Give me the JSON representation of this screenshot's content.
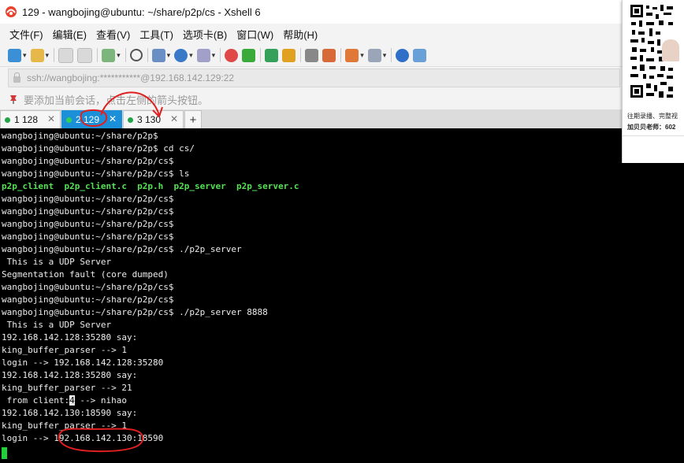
{
  "window": {
    "title": "129 - wangbojing@ubuntu: ~/share/p2p/cs - Xshell 6"
  },
  "menu": {
    "items": [
      {
        "label": "文件(F)"
      },
      {
        "label": "编辑(E)"
      },
      {
        "label": "查看(V)"
      },
      {
        "label": "工具(T)"
      },
      {
        "label": "选项卡(B)"
      },
      {
        "label": "窗口(W)"
      },
      {
        "label": "帮助(H)"
      }
    ]
  },
  "address": {
    "text": "ssh://wangbojing:***********@192.168.142.129:22"
  },
  "hint": {
    "text": "要添加当前会话，点击左侧的箭头按钮。"
  },
  "tabs": [
    {
      "label": "1 128",
      "active": false
    },
    {
      "label": "2 129",
      "active": true
    },
    {
      "label": "3 130",
      "active": false
    }
  ],
  "terminal": {
    "lines": [
      "wangbojing@ubuntu:~/share/p2p$",
      "wangbojing@ubuntu:~/share/p2p$ cd cs/",
      "wangbojing@ubuntu:~/share/p2p/cs$",
      "wangbojing@ubuntu:~/share/p2p/cs$ ls",
      "p2p_client  p2p_client.c  p2p.h  p2p_server  p2p_server.c",
      "wangbojing@ubuntu:~/share/p2p/cs$",
      "wangbojing@ubuntu:~/share/p2p/cs$",
      "wangbojing@ubuntu:~/share/p2p/cs$",
      "wangbojing@ubuntu:~/share/p2p/cs$",
      "wangbojing@ubuntu:~/share/p2p/cs$ ./p2p_server",
      " This is a UDP Server",
      "Segmentation fault (core dumped)",
      "wangbojing@ubuntu:~/share/p2p/cs$",
      "wangbojing@ubuntu:~/share/p2p/cs$",
      "wangbojing@ubuntu:~/share/p2p/cs$ ./p2p_server 8888",
      " This is a UDP Server",
      "192.168.142.128:35280 say:",
      "king_buffer_parser --> 1",
      "login --> 192.168.142.128:35280",
      "192.168.142.128:35280 say:",
      "king_buffer_parser --> 21",
      " from client:",
      "192.168.142.130:18590 say:",
      "king_buffer_parser --> 1",
      "login --> 192.168.142.130:18590"
    ],
    "from_client_highlight": "4",
    "from_client_tail": " --> nihao"
  },
  "qr_panel": {
    "caption1": "往期录播、完整视",
    "caption2": "加贝贝老师：602"
  },
  "colors": {
    "active_tab": "#1b8fd8",
    "terminal_bg": "#000000",
    "terminal_fg": "#ececec",
    "ls_green": "#55e055",
    "annotation_red": "#e02020"
  }
}
